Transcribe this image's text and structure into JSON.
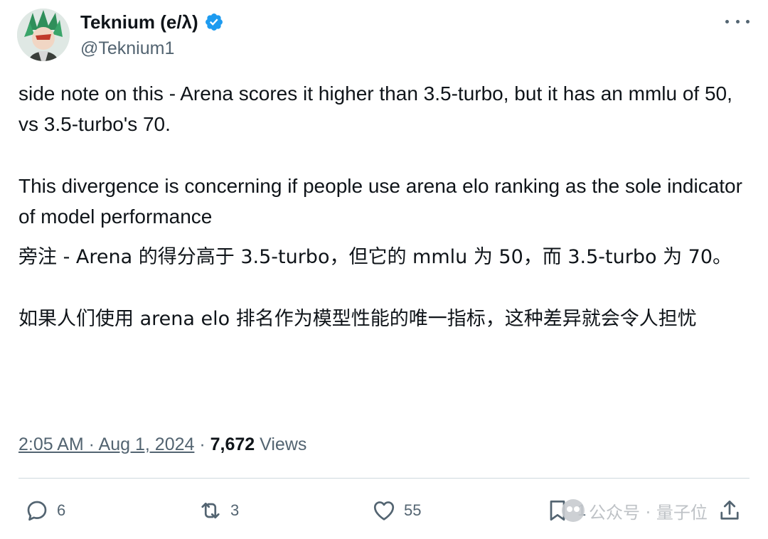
{
  "author": {
    "display_name": "Teknium (e/λ)",
    "handle": "@Teknium1"
  },
  "tweet": {
    "paragraphs": [
      "side note on this - Arena scores it higher than 3.5-turbo, but it has an mmlu of 50, vs 3.5-turbo's 70.",
      "This divergence is concerning if people use arena elo ranking as the sole indicator of model performance"
    ],
    "translation": [
      "旁注 - Arena 的得分高于 3.5-turbo，但它的 mmlu 为 50，而 3.5-turbo 为 70。",
      "如果人们使用 arena elo 排名作为模型性能的唯一指标，这种差异就会令人担忧"
    ]
  },
  "meta": {
    "timestamp": "2:05 AM · Aug 1, 2024",
    "separator": " · ",
    "views_count": "7,672",
    "views_label": "Views"
  },
  "actions": {
    "reply_count": "6",
    "retweet_count": "3",
    "like_count": "55",
    "bookmark_count": "1"
  },
  "watermark": {
    "text": "公众号 · 量子位"
  },
  "icons": {
    "verified": "verified-badge-icon",
    "more": "more-options-icon",
    "reply": "reply-icon",
    "retweet": "retweet-icon",
    "like": "heart-icon",
    "bookmark": "bookmark-icon",
    "share": "share-icon"
  },
  "colors": {
    "text_primary": "#0f1419",
    "text_secondary": "#536471",
    "verified_blue": "#1d9bf0",
    "divider": "#cfd9de"
  }
}
